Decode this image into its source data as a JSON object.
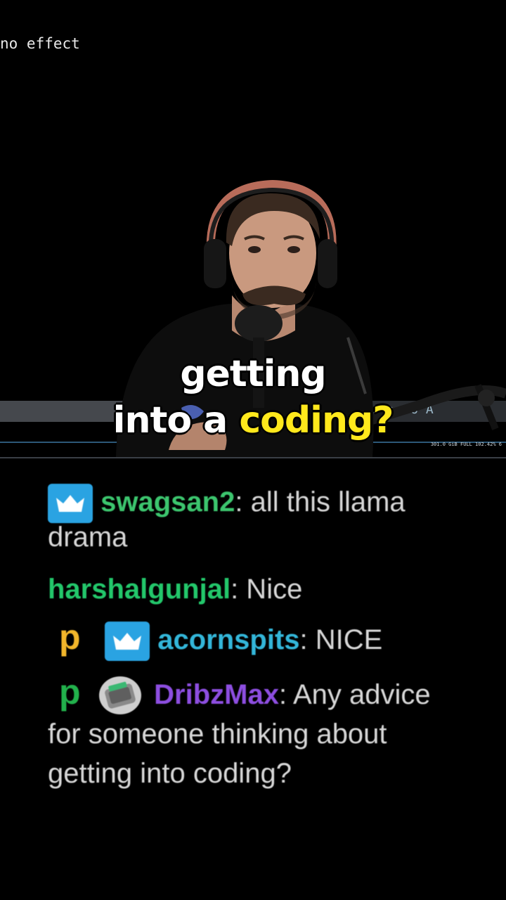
{
  "terminal": {
    "text": "no effect"
  },
  "status": {
    "info": "301.0 GiB FULL 102.42% 6",
    "mode": "d ;.-6 A"
  },
  "caption": {
    "line1": "getting",
    "line2_white": "into a",
    "line2_yellow": "coding?"
  },
  "chat": {
    "messages": [
      {
        "user": "swagsan2",
        "sep": ":",
        "text": " all this llama",
        "cont": "drama",
        "user_color": "#3cc56e"
      },
      {
        "user": "harshalgunjal",
        "sep": ":",
        "text": " Nice",
        "user_color": "#23c76b"
      },
      {
        "user": "acornspits",
        "sep": ":",
        "text": " NICE",
        "user_color": "#33b6d9"
      },
      {
        "user": "DribzMax",
        "sep": ":",
        "text": " Any advice",
        "cont1": "for someone thinking about",
        "cont2": "getting into coding?",
        "user_color": "#8d4ee0"
      }
    ],
    "badges": {
      "p_yellow": "#f2b62b",
      "p_green": "#22b14c",
      "sub": "#2aa3e2"
    }
  }
}
